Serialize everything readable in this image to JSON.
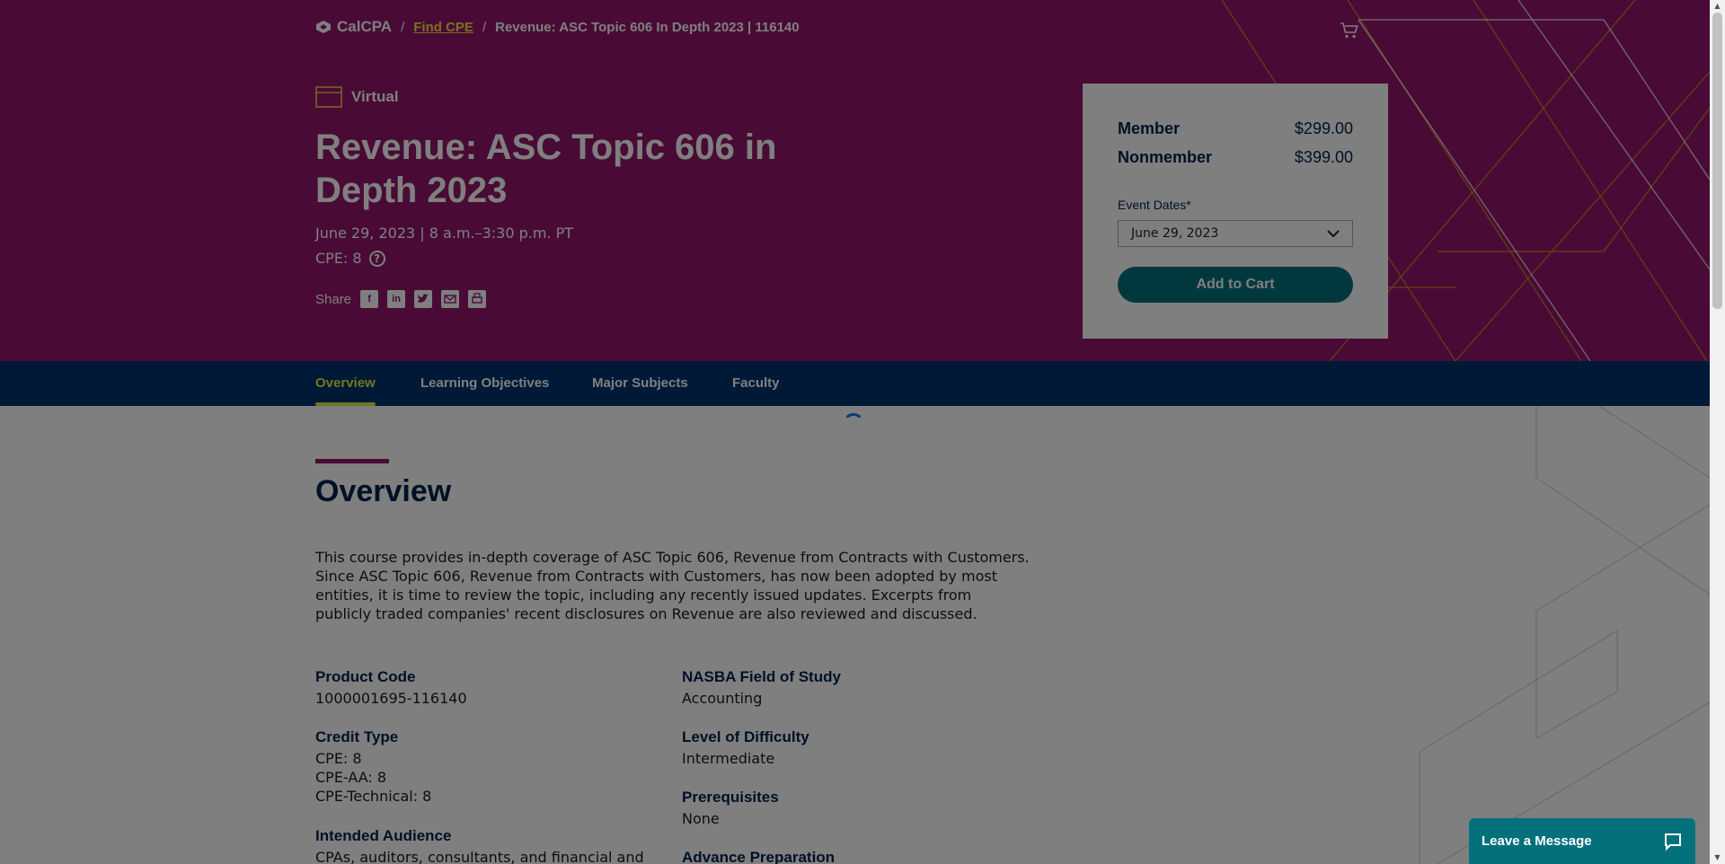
{
  "breadcrumb": {
    "logo_text": "CalCPA",
    "separator": "/",
    "link": "Find CPE",
    "current": "Revenue: ASC Topic 606 In Depth 2023 | 116140"
  },
  "hero": {
    "format": "Virtual",
    "title": "Revenue: ASC Topic 606 in Depth 2023",
    "dates": "June 29, 2023 | 8 a.m.–3:30 p.m. PT",
    "cpe": "CPE: 8",
    "help_glyph": "?",
    "share_label": "Share",
    "share_icons": [
      "facebook-icon",
      "linkedin-icon",
      "twitter-icon",
      "email-icon",
      "print-icon"
    ]
  },
  "pricing": {
    "member_label": "Member",
    "member_price": "$299.00",
    "nonmember_label": "Nonmember",
    "nonmember_price": "$399.00",
    "event_dates_label": "Event Dates*",
    "event_date_selected": "June 29, 2023",
    "add_to_cart": "Add to Cart"
  },
  "tabs": [
    "Overview",
    "Learning Objectives",
    "Major Subjects",
    "Faculty"
  ],
  "active_tab": "Overview",
  "overview": {
    "title": "Overview",
    "text": "This course provides in-depth coverage of ASC Topic 606, Revenue from Contracts with Customers. Since ASC Topic 606, Revenue from Contracts with Customers, has now been adopted by most entities, it is time to review the topic, including any recently issued updates. Excerpts from publicly traded companies' recent disclosures on Revenue are also reviewed and discussed.",
    "product_code_label": "Product Code",
    "product_code": "1000001695-116140",
    "credit_type_label": "Credit Type",
    "credit_types": [
      "CPE: 8",
      "CPE-AA: 8",
      "CPE-Technical: 8"
    ],
    "intended_audience_label": "Intended Audience",
    "intended_audience": "CPAs, auditors, consultants, and financial and",
    "field_of_study_label": "NASBA Field of Study",
    "field_of_study": "Accounting",
    "difficulty_label": "Level of Difficulty",
    "difficulty": "Intermediate",
    "prerequisites_label": "Prerequisites",
    "prerequisites": "None",
    "advance_prep_label": "Advance Preparation"
  },
  "chat": {
    "label": "Leave a Message"
  },
  "colors": {
    "hero": "#93176a",
    "nav": "#00326e",
    "accent_yellow": "#e1ef3b",
    "teal": "#03717c",
    "navy_text": "#00204a"
  }
}
